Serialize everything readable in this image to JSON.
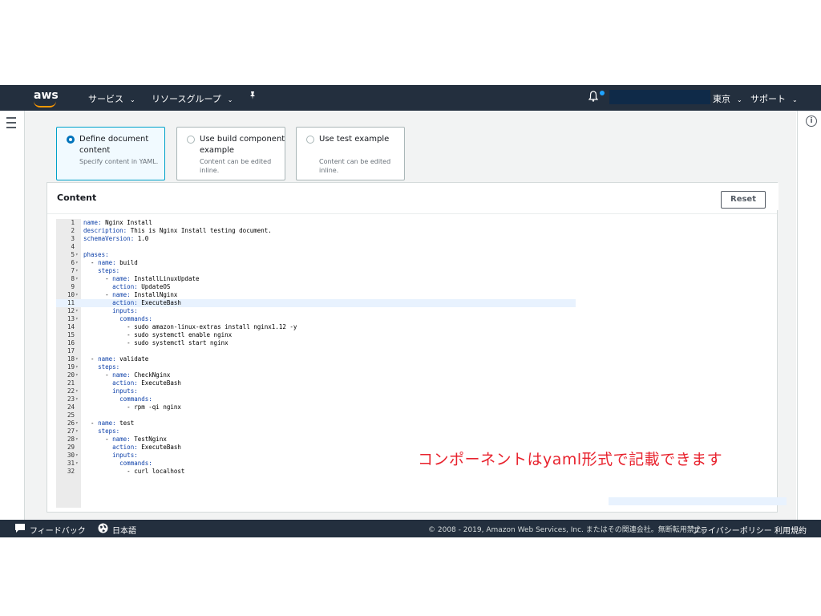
{
  "topnav": {
    "logo_text": "aws",
    "services": "サービス",
    "resource_groups": "リソースグループ",
    "region": "東京",
    "support": "サポート",
    "chevron": "⌄"
  },
  "options": [
    {
      "title": "Define document content",
      "desc": "Specify content in YAML.",
      "selected": true
    },
    {
      "title": "Use build component example",
      "desc": "Content can be edited inline.",
      "selected": false
    },
    {
      "title": "Use test example",
      "desc": "Content can be edited inline.",
      "selected": false
    }
  ],
  "content": {
    "title": "Content",
    "reset_label": "Reset"
  },
  "editor_lines": [
    {
      "n": "1",
      "fold": "",
      "code": "name: Nginx Install"
    },
    {
      "n": "2",
      "fold": "",
      "code": "description: This is Nginx Install testing document."
    },
    {
      "n": "3",
      "fold": "",
      "code": "schemaVersion: 1.0"
    },
    {
      "n": "4",
      "fold": "",
      "code": ""
    },
    {
      "n": "5",
      "fold": "▾",
      "code": "phases:"
    },
    {
      "n": "6",
      "fold": "▾",
      "code": "  - name: build"
    },
    {
      "n": "7",
      "fold": "▾",
      "code": "    steps:"
    },
    {
      "n": "8",
      "fold": "▾",
      "code": "      - name: InstallLinuxUpdate"
    },
    {
      "n": "9",
      "fold": "",
      "code": "        action: UpdateOS"
    },
    {
      "n": "10",
      "fold": "▾",
      "code": "      - name: InstallNginx"
    },
    {
      "n": "11",
      "fold": "",
      "code": "        action: ExecuteBash",
      "hl": true
    },
    {
      "n": "12",
      "fold": "▾",
      "code": "        inputs:"
    },
    {
      "n": "13",
      "fold": "▾",
      "code": "          commands:"
    },
    {
      "n": "14",
      "fold": "",
      "code": "            - sudo amazon-linux-extras install nginx1.12 -y"
    },
    {
      "n": "15",
      "fold": "",
      "code": "            - sudo systemctl enable nginx"
    },
    {
      "n": "16",
      "fold": "",
      "code": "            - sudo systemctl start nginx"
    },
    {
      "n": "17",
      "fold": "",
      "code": ""
    },
    {
      "n": "18",
      "fold": "▾",
      "code": "  - name: validate"
    },
    {
      "n": "19",
      "fold": "▾",
      "code": "    steps:"
    },
    {
      "n": "20",
      "fold": "▾",
      "code": "      - name: CheckNginx"
    },
    {
      "n": "21",
      "fold": "",
      "code": "        action: ExecuteBash"
    },
    {
      "n": "22",
      "fold": "▾",
      "code": "        inputs:"
    },
    {
      "n": "23",
      "fold": "▾",
      "code": "          commands:"
    },
    {
      "n": "24",
      "fold": "",
      "code": "            - rpm -qi nginx"
    },
    {
      "n": "25",
      "fold": "",
      "code": ""
    },
    {
      "n": "26",
      "fold": "▾",
      "code": "  - name: test"
    },
    {
      "n": "27",
      "fold": "▾",
      "code": "    steps:"
    },
    {
      "n": "28",
      "fold": "▾",
      "code": "      - name: TestNginx"
    },
    {
      "n": "29",
      "fold": "",
      "code": "        action: ExecuteBash"
    },
    {
      "n": "30",
      "fold": "▾",
      "code": "        inputs:"
    },
    {
      "n": "31",
      "fold": "▾",
      "code": "          commands:"
    },
    {
      "n": "32",
      "fold": "",
      "code": "            - curl localhost"
    }
  ],
  "annotation": "コンポーネントはyaml形式で記載できます",
  "footer": {
    "feedback": "フィードバック",
    "language": "日本語",
    "copyright": "© 2008 - 2019, Amazon Web Services, Inc. またはその関連会社。無断転用禁止。",
    "privacy": "プライバシーポリシー",
    "terms": "利用規約"
  },
  "colors": {
    "nav_bg": "#232f3e",
    "accent": "#ff9900",
    "selected_border": "#00a1c9",
    "annotation": "#e8232e"
  }
}
